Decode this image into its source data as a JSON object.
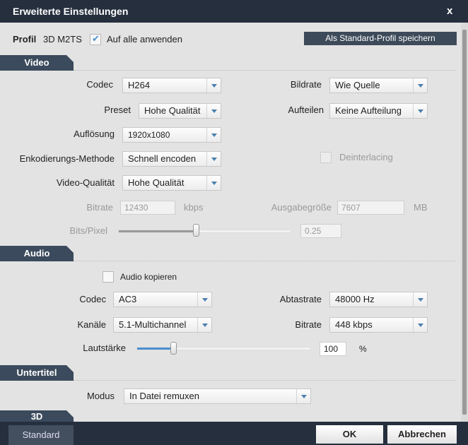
{
  "title": "Erweiterte Einstellungen",
  "close": "x",
  "profile": {
    "label": "Profil",
    "value": "3D M2TS",
    "apply_all": "Auf alle anwenden",
    "apply_all_checked": true,
    "save_button": "Als Standard-Profil speichern"
  },
  "video": {
    "tab": "Video",
    "codec_label": "Codec",
    "codec": "H264",
    "framerate_label": "Bildrate",
    "framerate": "Wie Quelle",
    "preset_label": "Preset",
    "preset": "Hohe Qualität",
    "split_label": "Aufteilen",
    "split": "Keine Aufteilung",
    "resolution_label": "Auflösung",
    "resolution": "1920x1080",
    "encoding_label": "Enkodierungs-Methode",
    "encoding": "Schnell encoden",
    "deinterlacing": "Deinterlacing",
    "quality_label": "Video-Qualität",
    "quality": "Hohe Qualität",
    "bitrate_label": "Bitrate",
    "bitrate": "12430",
    "bitrate_unit": "kbps",
    "size_label": "Ausgabegröße",
    "size": "7607",
    "size_unit": "MB",
    "bpp_label": "Bits/Pixel",
    "bpp": "0.25",
    "bpp_slider_fraction": 0.45
  },
  "audio": {
    "tab": "Audio",
    "copy": "Audio kopieren",
    "codec_label": "Codec",
    "codec": "AC3",
    "samplerate_label": "Abtastrate",
    "samplerate": "48000 Hz",
    "channels_label": "Kanäle",
    "channels": "5.1-Multichannel",
    "bitrate_label": "Bitrate",
    "bitrate": "448 kbps",
    "volume_label": "Lautstärke",
    "volume": "100",
    "volume_unit": "%",
    "volume_slider_fraction": 0.21
  },
  "subtitle": {
    "tab": "Untertitel",
    "mode_label": "Modus",
    "mode": "In Datei remuxen"
  },
  "three_d": {
    "tab": "3D"
  },
  "footer": {
    "standard": "Standard",
    "ok": "OK",
    "cancel": "Abbrechen"
  },
  "colors": {
    "titlebar": "#252f3d",
    "accent": "#4b7fb0",
    "tab": "#3b4a5c"
  }
}
